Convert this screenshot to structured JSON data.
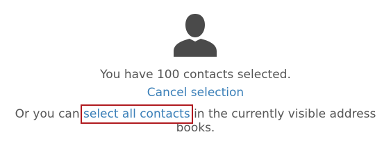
{
  "selection": {
    "summary": "You have 100 contacts selected.",
    "cancel_label": "Cancel selection",
    "prefix": "Or you can ",
    "select_all_label": "select all contacts",
    "suffix": " in the currently visible address books."
  },
  "icons": {
    "avatar": "person-silhouette-icon"
  },
  "colors": {
    "text": "#555555",
    "link": "#3a7fb8",
    "highlight": "#b0191e",
    "avatar": "#4a4a4a"
  }
}
